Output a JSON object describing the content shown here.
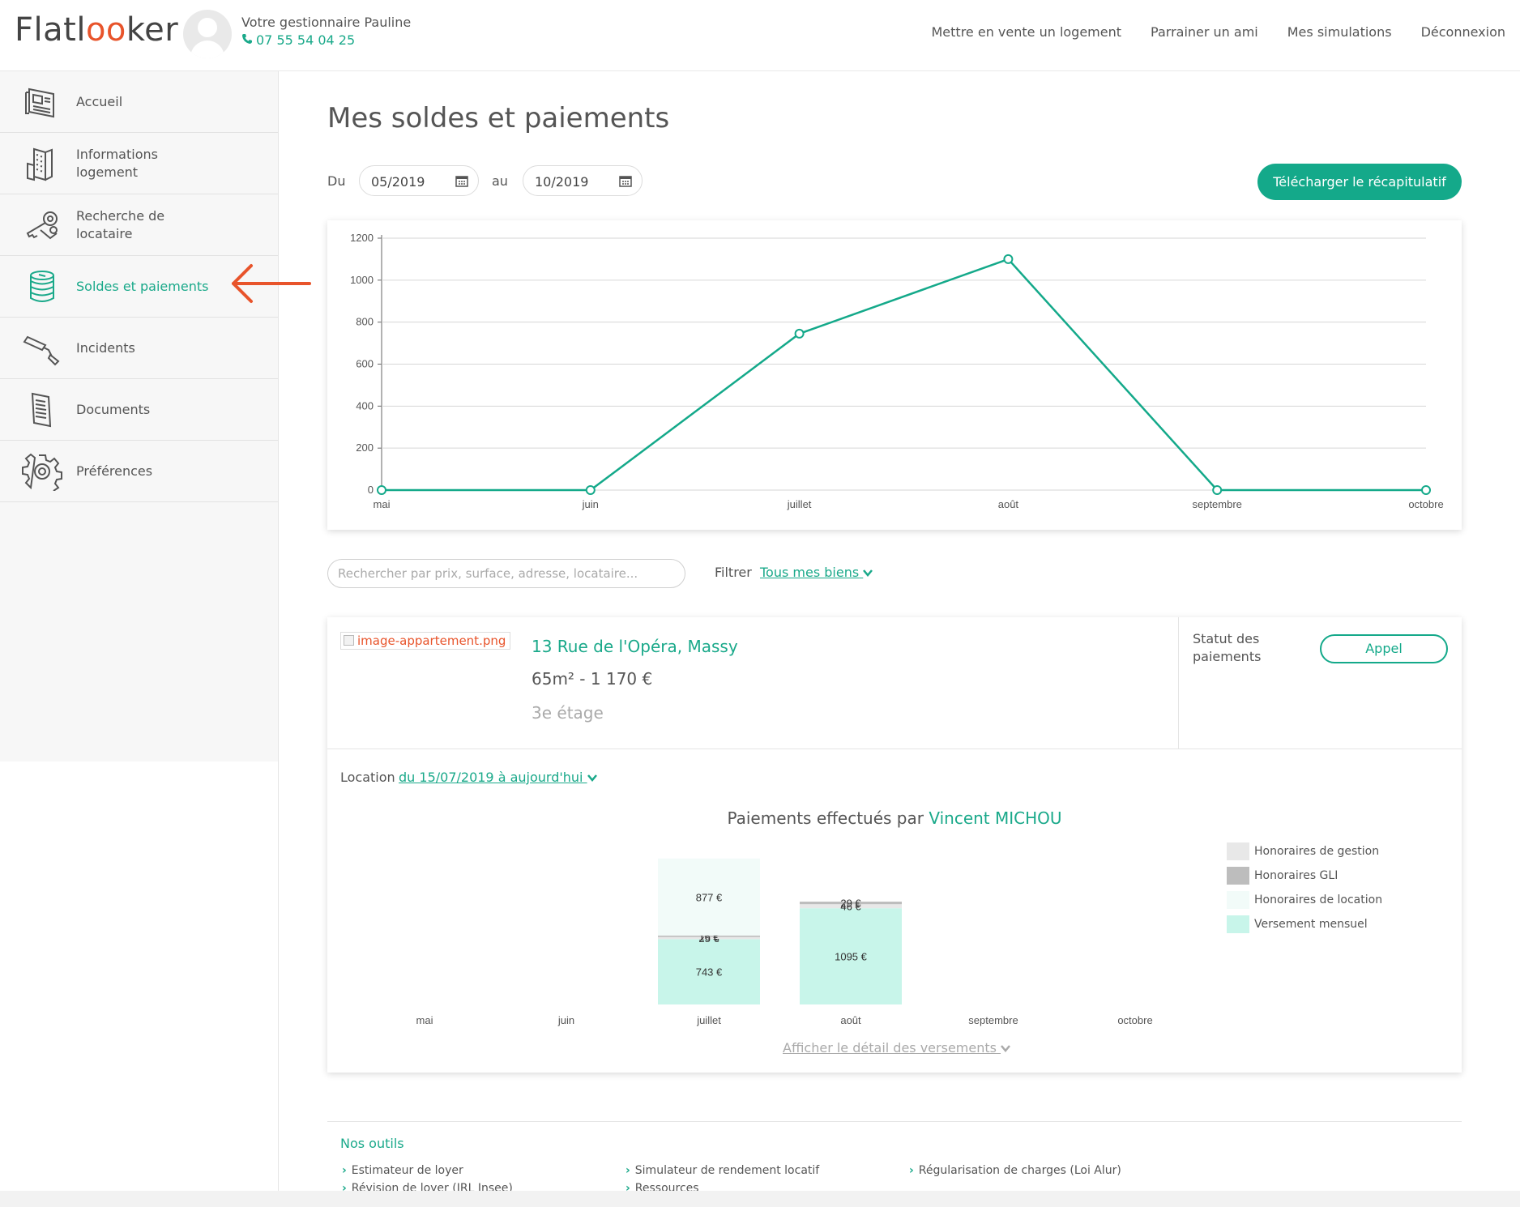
{
  "header": {
    "logo_prefix": "Flatl",
    "logo_oo": "oo",
    "logo_suffix": "ker",
    "manager_name": "Votre gestionnaire Pauline",
    "manager_phone": "07 55 54 04 25",
    "nav": [
      "Mettre en vente un logement",
      "Parrainer un ami",
      "Mes simulations",
      "Déconnexion"
    ]
  },
  "sidebar": {
    "items": [
      {
        "label": "Accueil",
        "icon": "newspaper-icon"
      },
      {
        "label": "Informations logement",
        "icon": "building-icon"
      },
      {
        "label": "Recherche de locataire",
        "icon": "keys-icon"
      },
      {
        "label": "Soldes et paiements",
        "icon": "coins-stack-icon",
        "active": true
      },
      {
        "label": "Incidents",
        "icon": "paint-roller-icon"
      },
      {
        "label": "Documents",
        "icon": "document-icon"
      },
      {
        "label": "Préférences",
        "icon": "gear-icon"
      }
    ]
  },
  "main": {
    "title": "Mes soldes et paiements",
    "date_from_label": "Du",
    "date_from": "05/2019",
    "date_to_label": "au",
    "date_to": "10/2019",
    "download_button": "Télécharger le récapitulatif",
    "search_placeholder": "Rechercher par prix, surface, adresse, locataire...",
    "filter_label": "Filtrer",
    "filter_value": "Tous mes biens"
  },
  "property": {
    "image_alt": "image-appartement.png",
    "address": "13 Rue de l'Opéra, Massy",
    "surface_price": "65m² - 1 170 €",
    "floor": "3e étage",
    "status_label": "Statut des paiements",
    "status_button": "Appel",
    "location_label": "Location",
    "location_period": "du 15/07/2019 à aujourd'hui",
    "payments_title": "Paiements effectués par",
    "tenant_name": "Vincent MICHOU",
    "detail_link": "Afficher le détail des versements"
  },
  "chart_data": [
    {
      "type": "line",
      "categories": [
        "mai",
        "juin",
        "juillet",
        "août",
        "septembre",
        "octobre"
      ],
      "series": [
        {
          "values": [
            0,
            0,
            745,
            1100,
            0,
            0
          ],
          "color": "#14a98a"
        }
      ],
      "ylim": [
        0,
        1200
      ],
      "yticks": [
        0,
        200,
        400,
        600,
        800,
        1000,
        1200
      ],
      "grid": true
    },
    {
      "type": "bar",
      "stacked": true,
      "categories": [
        "mai",
        "juin",
        "juillet",
        "août",
        "septembre",
        "octobre"
      ],
      "series": [
        {
          "name": "Versement mensuel",
          "color": "#c8f5ea",
          "values": [
            0,
            0,
            743,
            1095,
            0,
            0
          ],
          "labels": [
            "",
            "",
            "743 €",
            "1095 €",
            "",
            ""
          ]
        },
        {
          "name": "Honoraires de gestion",
          "color": "#e8e8e8",
          "values": [
            0,
            0,
            25,
            46,
            0,
            0
          ],
          "labels": [
            "",
            "",
            "25 €",
            "46 €",
            "",
            ""
          ]
        },
        {
          "name": "Honoraires GLI",
          "color": "#bdbdbd",
          "values": [
            0,
            0,
            16,
            29,
            0,
            0
          ],
          "labels": [
            "",
            "",
            "16 €",
            "29 €",
            "",
            ""
          ]
        },
        {
          "name": "Honoraires de location",
          "color": "#f2fbf9",
          "values": [
            0,
            0,
            877,
            0,
            0,
            0
          ],
          "labels": [
            "",
            "",
            "877 €",
            "",
            "",
            ""
          ]
        }
      ],
      "legend_order": [
        "Honoraires de gestion",
        "Honoraires GLI",
        "Honoraires de location",
        "Versement mensuel"
      ],
      "legend_position": "right"
    }
  ],
  "footer": {
    "tools_title": "Nos outils",
    "tools": [
      "Estimateur de loyer",
      "Simulateur de rendement locatif",
      "Régularisation de charges (Loi Alur)",
      "Révision de loyer (IRL Insee)",
      "Ressources"
    ]
  },
  "colors": {
    "accent": "#14a98a",
    "annotation_arrow": "#e8542b"
  }
}
